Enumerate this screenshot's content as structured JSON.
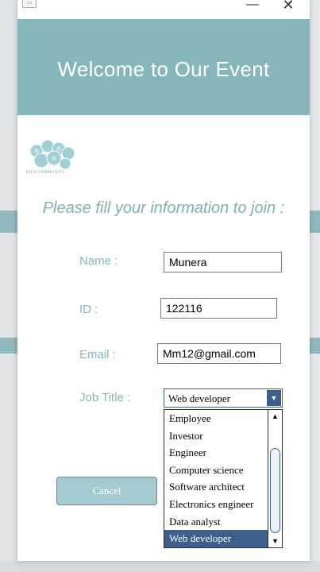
{
  "window": {
    "app_icon": "app-icon",
    "minimize_glyph": "—",
    "close_glyph": "✕"
  },
  "header": {
    "title": "Welcome to Our Event",
    "background": "#86b5ba"
  },
  "logo": {
    "icon": "tech-community-logo",
    "caption": "TECH COMMUNITY"
  },
  "form": {
    "subtitle": "Please fill your information to join :",
    "name_label": "Name :",
    "name_value": "Munera",
    "id_label": "ID :",
    "id_value": "122116",
    "email_label": "Email :",
    "email_value": "Mm12@gmail.com",
    "job_label": "Job Title :",
    "job_value": "Web developer",
    "job_options": [
      "Employee",
      "Investor",
      "Engineer",
      "Computer science",
      "Software architect",
      "Electronics engineer",
      "Data analyst",
      "Web developer"
    ],
    "cancel_label": "Cancel"
  },
  "colors": {
    "accent": "#86b5ba",
    "selection": "#3d5f8b"
  }
}
